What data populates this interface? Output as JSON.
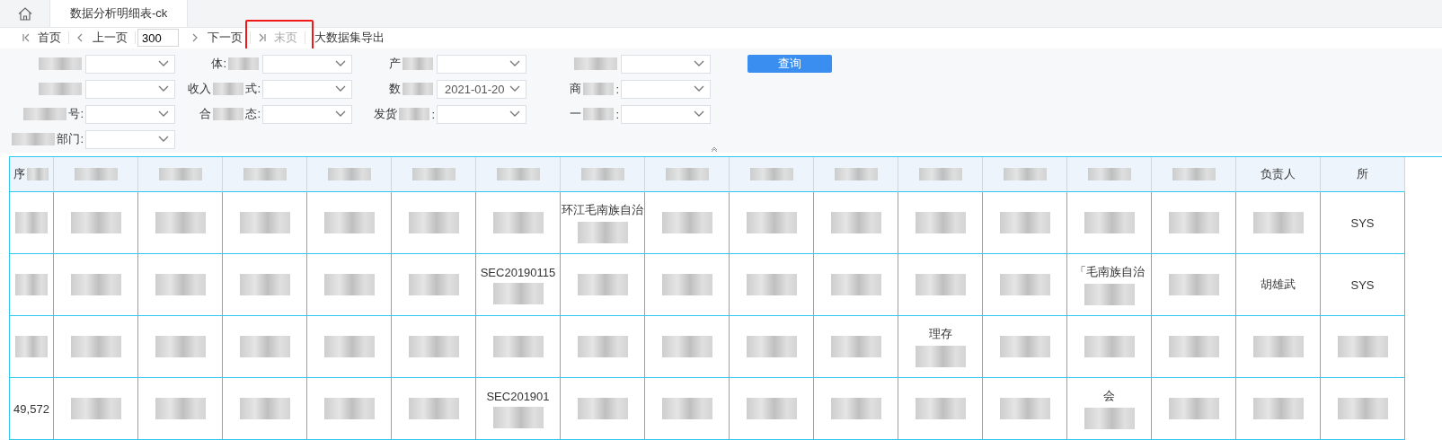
{
  "tabs": [
    {
      "kind": "home",
      "selected": false
    },
    {
      "kind": "text",
      "label": "数据分析明细表-ck",
      "selected": true
    }
  ],
  "toolbar": {
    "items": [
      {
        "kind": "nav",
        "label": "首页",
        "disabled": false
      },
      {
        "kind": "nav",
        "label": "上一页",
        "disabled": false
      },
      {
        "kind": "page",
        "value": "300"
      },
      {
        "kind": "nav",
        "label": "下一页",
        "disabled": false
      },
      {
        "kind": "nav",
        "label": "末页",
        "disabled": true,
        "highlighted": true
      },
      {
        "kind": "plain",
        "label": "大数据集导出"
      }
    ]
  },
  "filters": {
    "rows": [
      [
        {
          "redacted": true
        },
        {
          "label": "体:",
          "redacted": true
        },
        {
          "label": "产",
          "redacted": true
        },
        {
          "redacted": true
        }
      ],
      [
        {
          "redacted": true
        },
        {
          "label": "收入",
          "tail": "式:",
          "redacted": true
        },
        {
          "label": "数",
          "redacted": true,
          "value": "2021-01-20"
        },
        {
          "label": "商",
          "tail": ":",
          "redacted": true
        }
      ],
      [
        {
          "tail": "号:",
          "redacted": true
        },
        {
          "label": "合",
          "tail": "态:",
          "redacted": true
        },
        {
          "label": "发货",
          "tail": ":",
          "redacted": true
        },
        {
          "label": "一",
          "tail": ":",
          "redacted": true
        }
      ],
      [
        {
          "tail": "部门:",
          "redacted": true
        }
      ]
    ],
    "button": "查询"
  },
  "table": {
    "columns": [
      {
        "label": "序",
        "redacted": true
      },
      {
        "redacted": true
      },
      {
        "redacted": true
      },
      {
        "redacted": true
      },
      {
        "redacted": true
      },
      {
        "redacted": true
      },
      {
        "redacted": true
      },
      {
        "redacted": true
      },
      {
        "redacted": true
      },
      {
        "redacted": true
      },
      {
        "redacted": true
      },
      {
        "redacted": true
      },
      {
        "redacted": true
      },
      {
        "redacted": true
      },
      {
        "redacted": true
      },
      {
        "label": "负责人",
        "redacted": false
      },
      {
        "label": "所",
        "redacted": false
      }
    ],
    "rows": [
      {
        "cells": [
          {
            "redacted": true
          },
          {
            "redacted": true
          },
          {
            "redacted": true
          },
          {
            "redacted": true
          },
          {
            "redacted": true
          },
          {
            "redacted": true
          },
          {
            "redacted": true
          },
          {
            "text": "环江毛南族自治",
            "redacted": true
          },
          {
            "redacted": true
          },
          {
            "redacted": true
          },
          {
            "redacted": true
          },
          {
            "redacted": true
          },
          {
            "redacted": true
          },
          {
            "redacted": true
          },
          {
            "redacted": true
          },
          {
            "redacted": true
          },
          {
            "text": "SYS",
            "redacted": false
          }
        ]
      },
      {
        "cells": [
          {
            "redacted": true
          },
          {
            "redacted": true
          },
          {
            "redacted": true
          },
          {
            "redacted": true
          },
          {
            "redacted": true
          },
          {
            "redacted": true
          },
          {
            "text": "SEC20190115",
            "redacted": true
          },
          {
            "redacted": true
          },
          {
            "redacted": true
          },
          {
            "redacted": true
          },
          {
            "redacted": true
          },
          {
            "redacted": true
          },
          {
            "redacted": true
          },
          {
            "text": "「毛南族自治",
            "redacted": true
          },
          {
            "redacted": true
          },
          {
            "text": "胡雄武",
            "redacted": false
          },
          {
            "text": "SYS",
            "redacted": false
          }
        ]
      },
      {
        "cells": [
          {
            "redacted": true
          },
          {
            "redacted": true
          },
          {
            "redacted": true
          },
          {
            "redacted": true
          },
          {
            "redacted": true
          },
          {
            "redacted": true
          },
          {
            "redacted": true
          },
          {
            "redacted": true
          },
          {
            "redacted": true
          },
          {
            "redacted": true
          },
          {
            "redacted": true
          },
          {
            "text": "理存",
            "redacted": true
          },
          {
            "redacted": true
          },
          {
            "redacted": true
          },
          {
            "redacted": true
          },
          {
            "redacted": true
          },
          {
            "redacted": true
          }
        ]
      },
      {
        "cells": [
          {
            "text": "49,572",
            "redacted": false
          },
          {
            "redacted": true
          },
          {
            "redacted": true
          },
          {
            "redacted": true
          },
          {
            "redacted": true
          },
          {
            "redacted": true
          },
          {
            "text": "SEC201901",
            "redacted": true
          },
          {
            "redacted": true
          },
          {
            "redacted": true
          },
          {
            "redacted": true
          },
          {
            "redacted": true
          },
          {
            "redacted": true
          },
          {
            "redacted": true
          },
          {
            "text": "会",
            "redacted": true
          },
          {
            "redacted": true
          },
          {
            "redacted": true
          },
          {
            "redacted": true
          }
        ]
      }
    ]
  }
}
